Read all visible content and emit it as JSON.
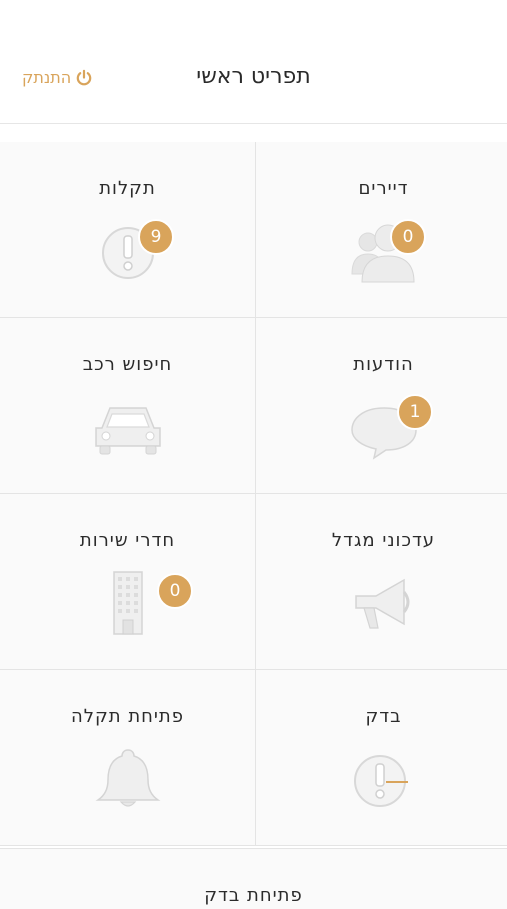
{
  "header": {
    "title": "תפריט ראשי",
    "logout_label": "התנתק",
    "accent_color": "#d9a45b"
  },
  "tiles": [
    {
      "label": "דיירים",
      "icon": "residents-icon",
      "badge": "0"
    },
    {
      "label": "תקלות",
      "icon": "faults-icon",
      "badge": "9"
    },
    {
      "label": "הודעות",
      "icon": "messages-icon",
      "badge": "1"
    },
    {
      "label": "חיפוש רכב",
      "icon": "car-icon",
      "badge": null
    },
    {
      "label": "עדכוני מגדל",
      "icon": "megaphone-icon",
      "badge": null
    },
    {
      "label": "חדרי שירות",
      "icon": "building-icon",
      "badge": "0"
    },
    {
      "label": "בדק",
      "icon": "inspection-icon",
      "badge": null
    },
    {
      "label": "פתיחת תקלה",
      "icon": "bell-icon",
      "badge": null
    }
  ],
  "bottom_tile": {
    "label": "פתיחת בדק"
  }
}
